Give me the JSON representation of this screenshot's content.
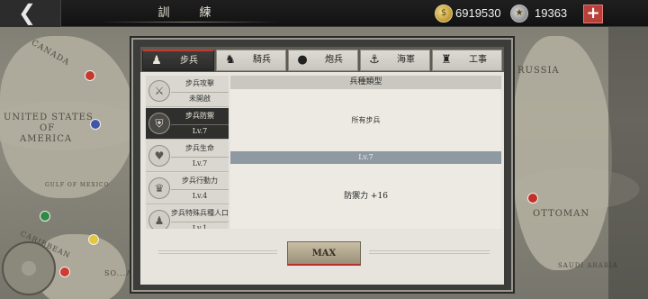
{
  "header": {
    "back_icon": "chevron-left-icon",
    "title": "訓　練",
    "gold_amount": "6919530",
    "silver_amount": "19363",
    "gold_icon": "gold-coin-icon",
    "silver_icon": "silver-coin-icon",
    "add_label": "+"
  },
  "map": {
    "labels": {
      "canada": "CANADA",
      "usa_1": "UNITED STATES",
      "usa_2": "OF",
      "usa_3": "AMERICA",
      "gulf": "GULF OF MEXICO",
      "caribbean": "CARIBBEAN",
      "russia": "RUSSIA",
      "ottoman": "OTTOMAN",
      "saudi": "SAUDI ARABIA",
      "south_america": "SO...AMERICA"
    }
  },
  "tabs": [
    {
      "label": "步兵",
      "icon": "infantry-icon",
      "active": true
    },
    {
      "label": "騎兵",
      "icon": "horse-icon",
      "active": false
    },
    {
      "label": "炮兵",
      "icon": "cannon-icon",
      "active": false
    },
    {
      "label": "海軍",
      "icon": "anchor-icon",
      "active": false
    },
    {
      "label": "工事",
      "icon": "fortification-icon",
      "active": false
    }
  ],
  "skills": [
    {
      "name": "步兵攻擊",
      "level": "未開啟",
      "icon": "crossed-swords-icon",
      "selected": false
    },
    {
      "name": "步兵防禦",
      "level": "Lv.7",
      "icon": "shield-icon",
      "selected": true
    },
    {
      "name": "步兵生命",
      "level": "Lv.7",
      "icon": "heart-icon",
      "selected": false
    },
    {
      "name": "步兵行動力",
      "level": "Lv.4",
      "icon": "boot-icon",
      "selected": false
    },
    {
      "name": "步兵特殊兵種人口",
      "level": "Lv.1",
      "icon": "soldier-icon",
      "selected": false
    }
  ],
  "detail": {
    "header": "兵種類型",
    "target": "所有步兵",
    "level": "Lv.7",
    "effect": "防禦力 +16"
  },
  "actions": {
    "max_label": "MAX"
  },
  "colors": {
    "accent_red": "#c23b32",
    "level_bar": "#8e99a2",
    "topbar": "#121212"
  }
}
